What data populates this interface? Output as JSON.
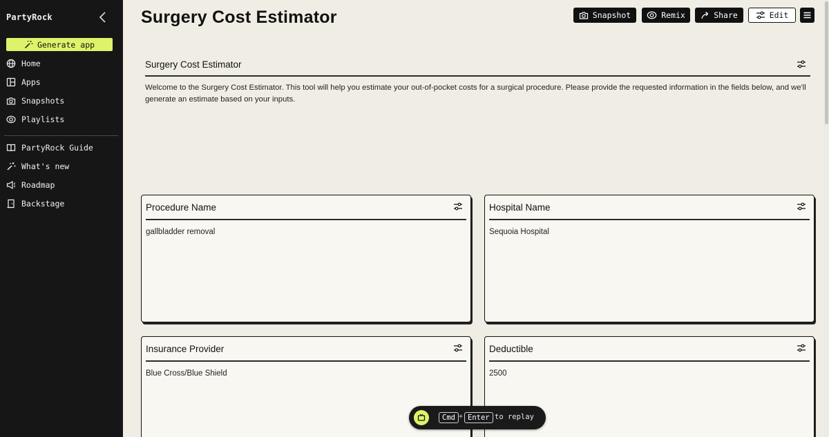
{
  "sidebar": {
    "brand": "PartyRock",
    "generate_label": "Generate app",
    "items": [
      {
        "label": "Home",
        "icon": "globe-icon"
      },
      {
        "label": "Apps",
        "icon": "apps-icon"
      },
      {
        "label": "Snapshots",
        "icon": "camera-icon"
      },
      {
        "label": "Playlists",
        "icon": "playlists-icon"
      },
      {
        "label": "PartyRock Guide",
        "icon": "book-icon"
      },
      {
        "label": "What's new",
        "icon": "sparkle-icon"
      },
      {
        "label": "Roadmap",
        "icon": "megaphone-icon"
      },
      {
        "label": "Backstage",
        "icon": "backstage-icon"
      }
    ]
  },
  "header": {
    "title": "Surgery Cost Estimator",
    "snapshot_label": "Snapshot",
    "remix_label": "Remix",
    "share_label": "Share",
    "edit_label": "Edit"
  },
  "intro": {
    "title": "Surgery Cost Estimator",
    "text": "Welcome to the Surgery Cost Estimator. This tool will help you estimate your out-of-pocket costs for a surgical procedure. Please provide the requested information in the fields below, and we'll generate an estimate based on your inputs."
  },
  "cards": [
    {
      "title": "Procedure Name",
      "value": "gallbladder removal"
    },
    {
      "title": "Hospital Name",
      "value": "Sequoia Hospital"
    },
    {
      "title": "Insurance Provider",
      "value": "Blue Cross/Blue Shield"
    },
    {
      "title": "Deductible",
      "value": "2500"
    }
  ],
  "replay": {
    "key1": "Cmd",
    "plus": "+",
    "key2": "Enter",
    "text": "to replay"
  },
  "colors": {
    "accent": "#dff36a",
    "sidebar_bg": "#161616",
    "page_bg": "#f0eee4"
  }
}
